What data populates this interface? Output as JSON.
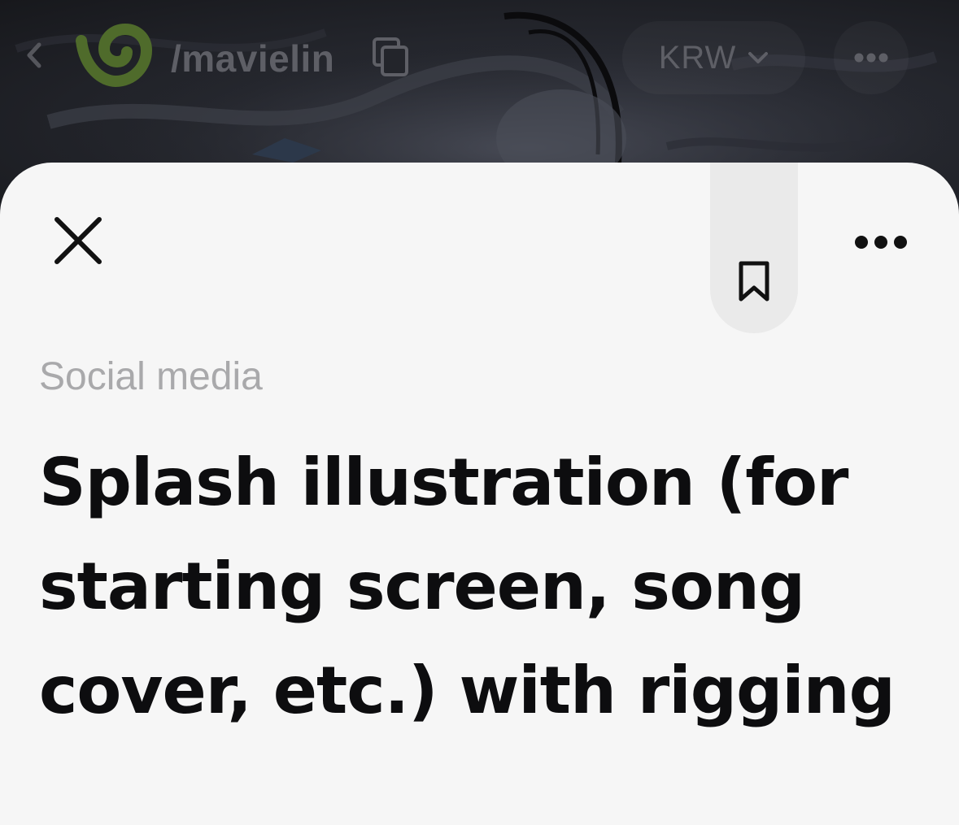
{
  "header": {
    "back_icon": "chevron-left-icon",
    "logo_icon": "brand-logo-icon",
    "profile_handle": "/mavielin",
    "copy_icon": "copy-icon",
    "currency": "KRW",
    "currency_icon": "chevron-down-icon",
    "more_icon": "more-horizontal-icon"
  },
  "sheet": {
    "close_icon": "close-icon",
    "bookmark_icon": "bookmark-icon",
    "more_icon": "more-horizontal-icon",
    "category": "Social media",
    "title": "Splash illustration (for starting screen, song cover, etc.) with rigging"
  },
  "colors": {
    "logo_green": "#4f6b2b",
    "sheet_background": "#f6f6f6",
    "bookmark_pill": "#eaeaea",
    "category_text": "#a9a9ab",
    "title_text": "#0d0d0f"
  }
}
